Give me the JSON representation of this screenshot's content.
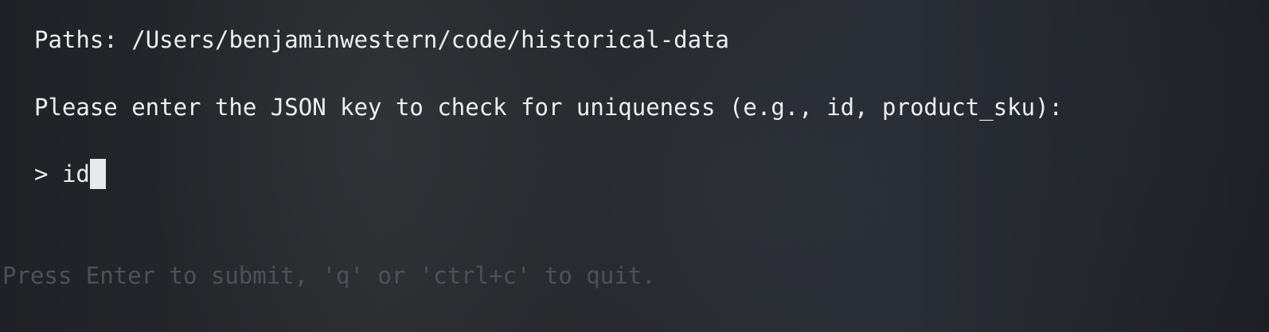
{
  "terminal": {
    "paths_label": "Paths:",
    "paths_value": "/Users/benjaminwestern/code/historical-data",
    "prompt_text": "Please enter the JSON key to check for uniqueness (e.g., id, product_sku):",
    "input_prompt_symbol": ">",
    "input_value": "id",
    "hint_text": "Press Enter to submit, 'q' or 'ctrl+c' to quit."
  },
  "colors": {
    "foreground": "#eceef1",
    "hint": "#4e5158",
    "cursor": "#e8e9ec"
  }
}
